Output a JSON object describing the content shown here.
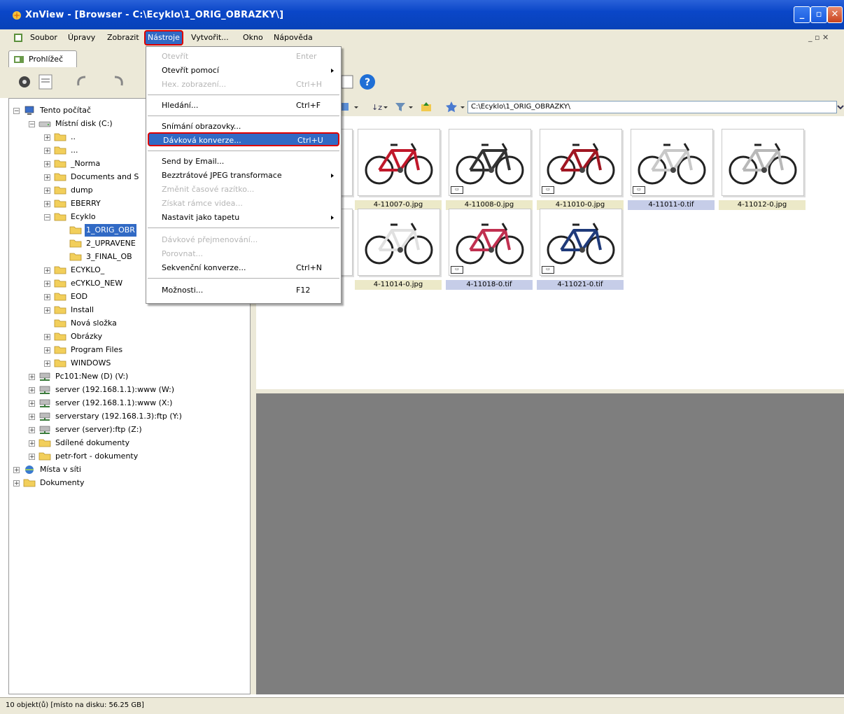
{
  "window": {
    "title": "XnView - [Browser - C:\\Ecyklo\\1_ORIG_OBRAZKY\\]",
    "colors": {
      "titlebar": "#0a46c8",
      "highlight": "#316ac5",
      "annotation": "#dd0000"
    }
  },
  "menubar": {
    "items": [
      "Soubor",
      "Úpravy",
      "Zobrazit",
      "Nástroje",
      "Vytvořit...",
      "Okno",
      "Nápověda"
    ],
    "active": "Nástroje",
    "right_controls": "_ ▫ ✕"
  },
  "tab": {
    "label": "Prohlížeč"
  },
  "address": {
    "path": "C:\\Ecyklo\\1_ORIG_OBRAZKY\\"
  },
  "tools_menu": {
    "items": [
      {
        "label": "Otevřít",
        "shortcut": "Enter",
        "disabled": true
      },
      {
        "label": "Otevřít pomocí",
        "shortcut": "",
        "submenu": true
      },
      {
        "label": "Hex. zobrazení...",
        "shortcut": "Ctrl+H",
        "disabled": true
      },
      {
        "label": "Hledání...",
        "shortcut": "Ctrl+F"
      },
      {
        "label": "Snímání obrazovky...",
        "shortcut": ""
      },
      {
        "label": "Dávková konverze...",
        "shortcut": "Ctrl+U",
        "highlighted": true
      },
      {
        "label": "Send by Email...",
        "shortcut": ""
      },
      {
        "label": "Bezztrátové JPEG transformace",
        "shortcut": "",
        "submenu": true
      },
      {
        "label": "Změnit časové razítko...",
        "shortcut": "",
        "disabled": true
      },
      {
        "label": "Získat rámce videa...",
        "shortcut": "",
        "disabled": true
      },
      {
        "label": "Nastavit jako tapetu",
        "shortcut": "",
        "submenu": true
      },
      {
        "label": "Dávkové přejmenování...",
        "shortcut": "",
        "disabled": true
      },
      {
        "label": "Porovnat...",
        "shortcut": "",
        "disabled": true
      },
      {
        "label": "Sekvenční konverze...",
        "shortcut": "Ctrl+N"
      },
      {
        "label": "Možnosti...",
        "shortcut": "F12"
      }
    ]
  },
  "tree": {
    "items": [
      "Tento počítač",
      "Místní disk (C:)",
      "..",
      "...",
      "_Norma",
      "Documents and S",
      "dump",
      "EBERRY",
      "Ecyklo",
      "1_ORIG_OBR",
      "2_UPRAVENE",
      "3_FINAL_OB",
      "ECYKLO_",
      "eCYKLO_NEW",
      "EOD",
      "Install",
      "Nová složka",
      "Obrázky",
      "Program Files",
      "WINDOWS",
      "Pc101:New (D) (V:)",
      "server (192.168.1.1):www (W:)",
      "server (192.168.1.1):www (X:)",
      "serverstary (192.168.1.3):ftp (Y:)",
      "server (server):ftp (Z:)",
      "Sdílené dokumenty",
      "petr-fort - dokumenty",
      "Místa v síti",
      "Dokumenty"
    ]
  },
  "thumbnails": [
    {
      "name": "4-11007-0.jpg",
      "type": "jpg",
      "frame": "#c0182a"
    },
    {
      "name": "4-11008-0.jpg",
      "type": "jpg",
      "frame": "#333333"
    },
    {
      "name": "4-11010-0.jpg",
      "type": "jpg",
      "frame": "#a01622"
    },
    {
      "name": "4-11011-0.tif",
      "type": "tif",
      "frame": "#c8c8c8"
    },
    {
      "name": "4-11012-0.jpg",
      "type": "jpg",
      "frame": "#b8b8b8"
    },
    {
      "name": "4-11014-0.jpg",
      "type": "jpg",
      "frame": "#e0e0e0"
    },
    {
      "name": "4-11018-0.tif",
      "type": "tif",
      "frame": "#c03050"
    },
    {
      "name": "4-11021-0.tif",
      "type": "tif",
      "frame": "#1f3a7a"
    }
  ],
  "status": {
    "text": "10 objekt(ů) [místo na disku: 56.25 GB]"
  }
}
